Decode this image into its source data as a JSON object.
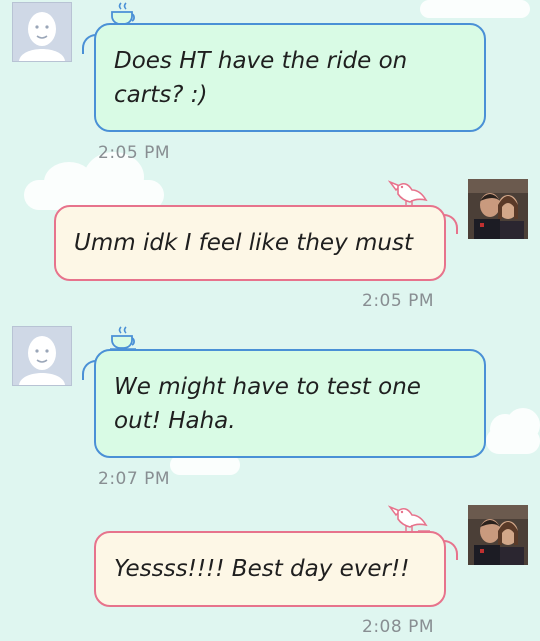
{
  "messages": [
    {
      "direction": "incoming",
      "text": "Does HT have the ride on carts? :)",
      "time": "2:05 PM",
      "avatar_icon": "default-user-avatar-icon",
      "deco_icon": "coffee-cup-icon"
    },
    {
      "direction": "outgoing",
      "text": "Umm idk I feel like they must",
      "time": "2:05 PM",
      "avatar_icon": "photo-avatar",
      "deco_icon": "bird-icon"
    },
    {
      "direction": "incoming",
      "text": "We might have to test one out! Haha.",
      "time": "2:07 PM",
      "avatar_icon": "default-user-avatar-icon",
      "deco_icon": "coffee-cup-icon"
    },
    {
      "direction": "outgoing",
      "text": "Yessss!!!! Best day ever!!",
      "time": "2:08 PM",
      "avatar_icon": "photo-avatar",
      "deco_icon": "bird-icon"
    }
  ],
  "colors": {
    "background": "#dff6f0",
    "incoming_bubble": "#d9fbe5",
    "incoming_border": "#4a90d6",
    "outgoing_bubble": "#fdf7e6",
    "outgoing_border": "#e7738c",
    "timestamp": "#888e92"
  }
}
